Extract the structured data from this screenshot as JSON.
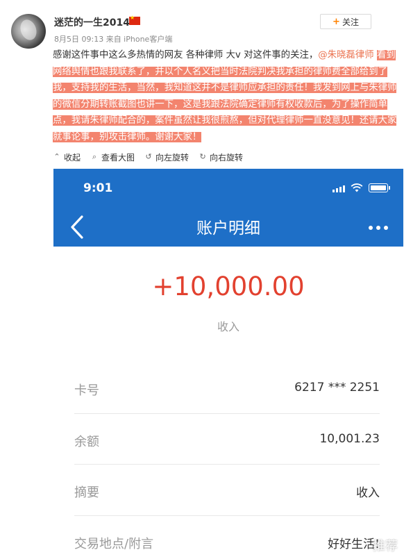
{
  "post": {
    "username": "迷茫的一生2014",
    "meta": "8月5日 09:13 来自 iPhone客户端",
    "follow_label": "关注",
    "text_plain": "感谢这件事中这么多热情的网友 各种律师 大v 对这件事的关注，",
    "mention": "@朱晓磊律师",
    "text_highlight": "看到网络舆情也跟我联系了，并以个人名义把当时法院判决我承担的律师费全部给到了我，支持我的生活，当然，我知道这并不是律师应承担的责任！我发到网上与朱律师的微信分期转账截图也讲一下，这是我跟法院确定律师有权收款后，为了操作简单点，我请朱律师配合的，案件虽然让我很煎熬，但对代理律师一直没意见！还请大家就事论事，别攻击律师。谢谢大家！"
  },
  "toolbar": {
    "collapse": "收起",
    "view_large": "查看大图",
    "rotate_left": "向左旋转",
    "rotate_right": "向右旋转"
  },
  "screenshot": {
    "status_time": "9:01",
    "nav_title": "账户明细",
    "amount": "+10,000.00",
    "amount_label": "收入",
    "rows": [
      {
        "key": "卡号",
        "value": "6217 *** 2251"
      },
      {
        "key": "余额",
        "value": "10,001.23"
      },
      {
        "key": "摘要",
        "value": "收入"
      },
      {
        "key": "交易地点/附言",
        "value": "好好生活!"
      }
    ],
    "watermark": "推荐"
  },
  "colors": {
    "highlight": "#f3846e",
    "mention": "#eb7350",
    "phone_header": "#1e6fc7",
    "amount": "#e2412f"
  }
}
